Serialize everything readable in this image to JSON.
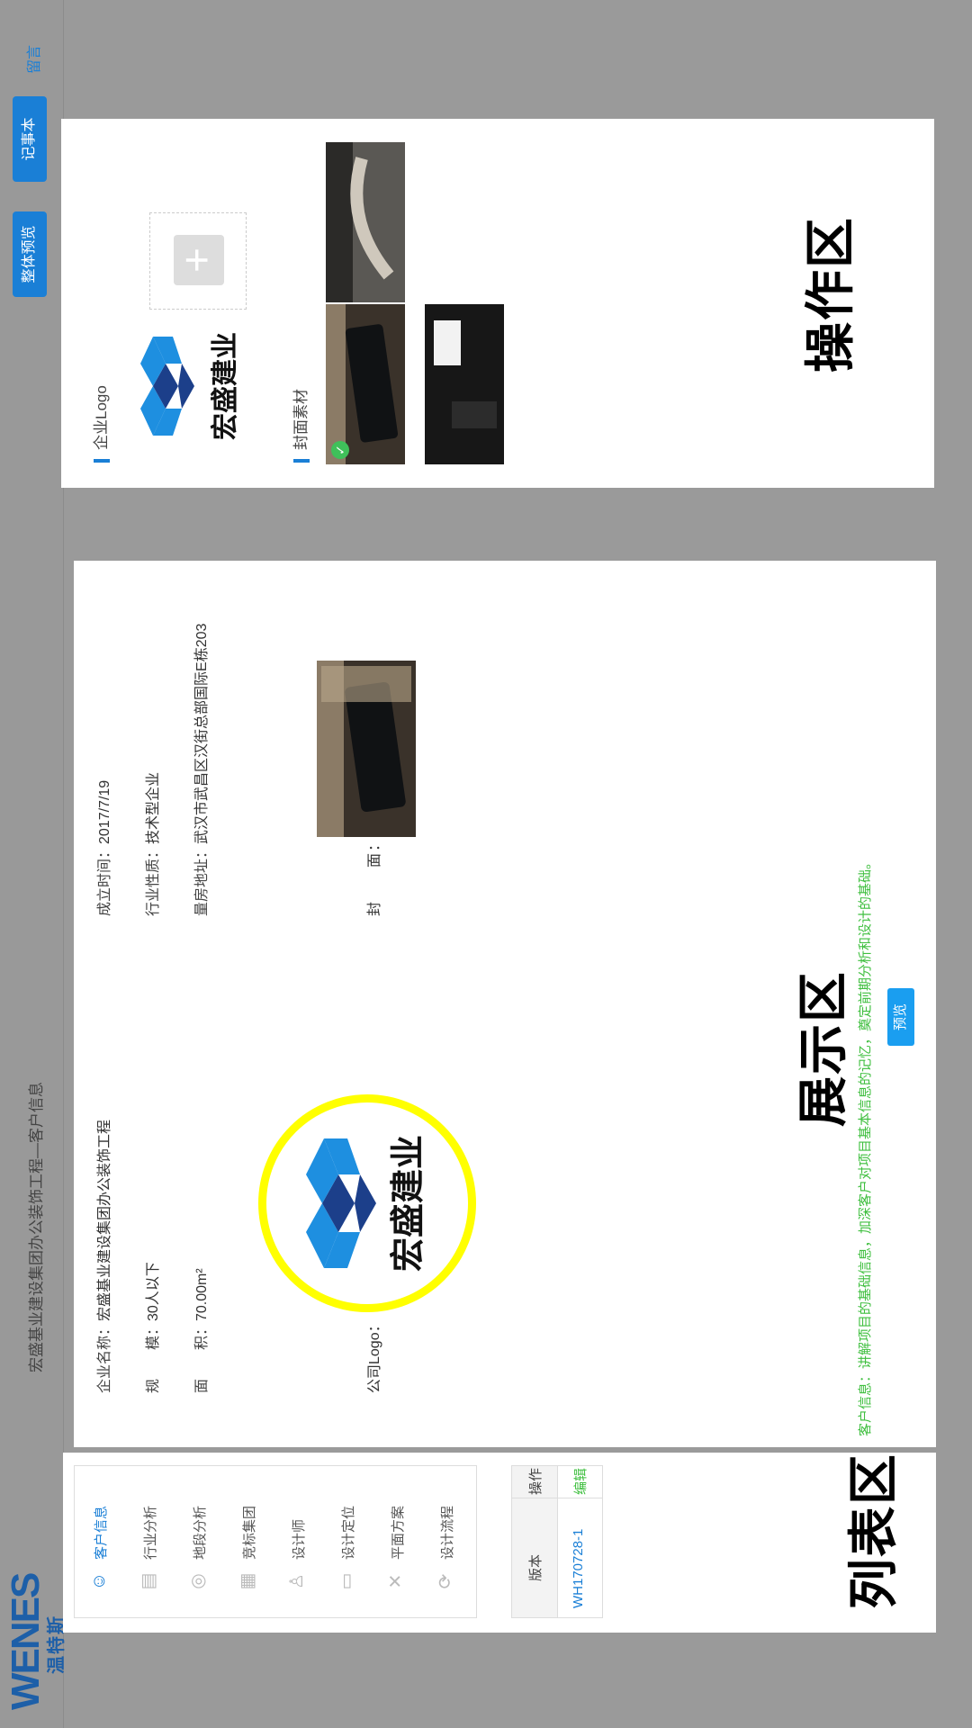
{
  "header": {
    "brand_main": "WENES",
    "brand_sub": "温特斯",
    "breadcrumb": "宏盛基业建设集团办公装饰工程—客户信息",
    "preview_all_label": "整体预览",
    "notebook_label": "记事本",
    "leave_note_label": "留言"
  },
  "list_zone": {
    "zone_title": "列表区",
    "nav": [
      {
        "label": "客户信息",
        "icon": "user-icon",
        "active": true
      },
      {
        "label": "行业分析",
        "icon": "chart-icon",
        "active": false
      },
      {
        "label": "地段分析",
        "icon": "location-icon",
        "active": false
      },
      {
        "label": "竞标集团",
        "icon": "building-icon",
        "active": false
      },
      {
        "label": "设计师",
        "icon": "designer-icon",
        "active": false
      },
      {
        "label": "设计定位",
        "icon": "document-icon",
        "active": false
      },
      {
        "label": "平面方案",
        "icon": "tools-icon",
        "active": false
      },
      {
        "label": "设计流程",
        "icon": "flow-icon",
        "active": false
      }
    ],
    "version_table": {
      "col_version": "版本",
      "col_action": "操作",
      "rows": [
        {
          "version": "WH170728-1",
          "action": "编辑"
        }
      ]
    }
  },
  "display_zone": {
    "zone_title": "展示区",
    "company_name_label": "企业名称：",
    "company_name": "宏盛基业建设集团办公装饰工程",
    "founded_label": "成立时间：",
    "founded": "2017/7/19",
    "scale_label": "规　　模：",
    "scale": "30人以下",
    "nature_label": "行业性质：",
    "nature": "技术型企业",
    "area_label": "面　　积：",
    "area": "70.00m²",
    "address_label": "量房地址：",
    "address": "武汉市武昌区汉街总部国际E栋203",
    "logo_label": "公司Logo：",
    "cover_label": "封　　面：",
    "logo_text": "宏盛建业",
    "hint": "客户信息：讲解项目的基础信息，加深客户对项目基本信息的记忆，奠定前期分析和设计的基础。",
    "preview_label": "预览"
  },
  "operate_zone": {
    "zone_title": "操作区",
    "logo_section_title": "企业Logo",
    "logo_text": "宏盛建业",
    "cover_section_title": "封面素材",
    "add_icon": "plus-icon"
  },
  "colors": {
    "accent": "#1a7fd6",
    "hint_green": "#3fbf3f",
    "highlight_yellow": "#ffff00",
    "logo_blue": "#1e8fe0",
    "logo_dark": "#1c3f8a"
  }
}
